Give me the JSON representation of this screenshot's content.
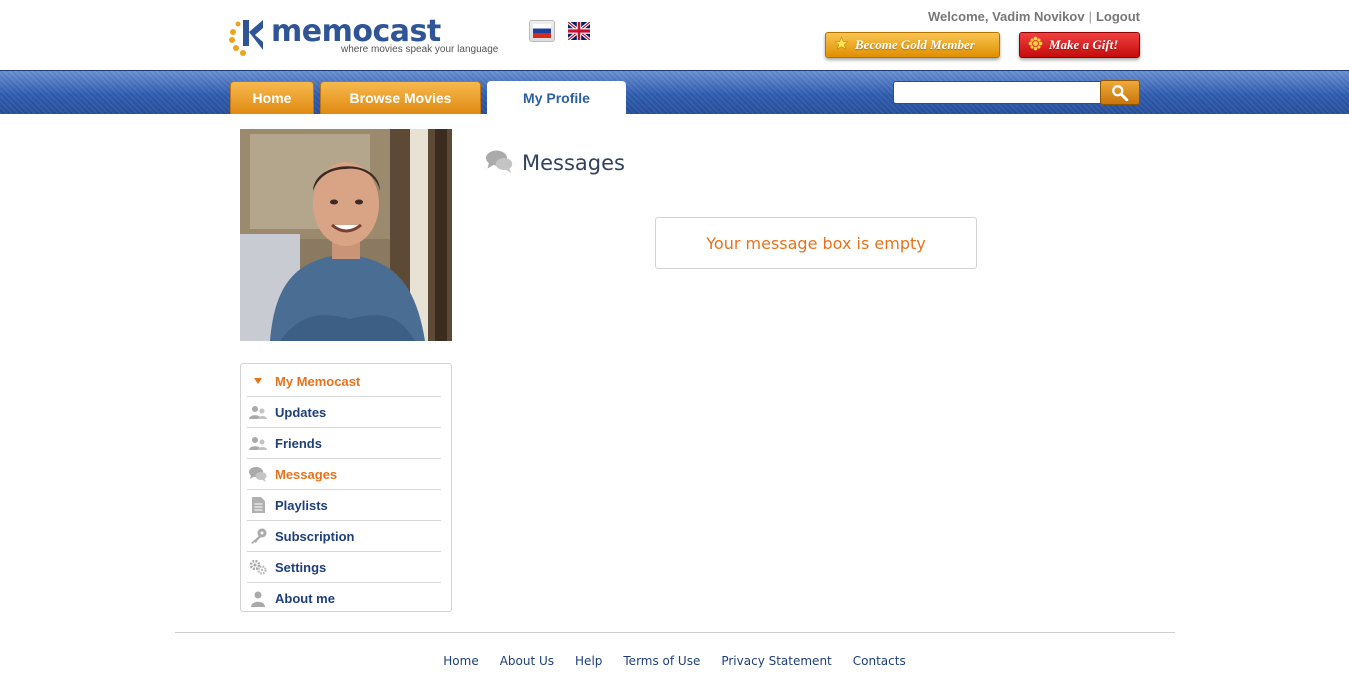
{
  "brand": {
    "name": "memocast",
    "tagline": "where movies speak your language"
  },
  "languages": [
    {
      "code": "ru",
      "icon": "russian-flag-icon"
    },
    {
      "code": "en",
      "icon": "uk-flag-icon"
    }
  ],
  "user_bar": {
    "welcome": "Welcome, Vadim Novikov",
    "separator": "|",
    "logout": "Logout"
  },
  "promo": {
    "gold_label": "Become Gold Member",
    "gift_label": "Make a Gift!"
  },
  "nav": {
    "tabs": [
      {
        "label": "Home"
      },
      {
        "label": "Browse Movies"
      },
      {
        "label": "My Profile"
      }
    ],
    "active_tab": "My Profile"
  },
  "search": {
    "value": "",
    "placeholder": ""
  },
  "sidebar": {
    "items": [
      {
        "label": "My Memocast",
        "icon": "triangle-down-icon"
      },
      {
        "label": "Updates",
        "icon": "people-icon"
      },
      {
        "label": "Friends",
        "icon": "people-icon"
      },
      {
        "label": "Messages",
        "icon": "speech-bubbles-icon"
      },
      {
        "label": "Playlists",
        "icon": "document-icon"
      },
      {
        "label": "Subscription",
        "icon": "key-icon"
      },
      {
        "label": "Settings",
        "icon": "gears-icon"
      },
      {
        "label": "About me",
        "icon": "person-icon"
      }
    ],
    "active_item": "Messages"
  },
  "main": {
    "title": "Messages",
    "empty_text": "Your message box is empty"
  },
  "footer": {
    "links": [
      "Home",
      "About Us",
      "Help",
      "Terms of Use",
      "Privacy Statement",
      "Contacts"
    ]
  },
  "colors": {
    "accent_orange": "#e8731c",
    "nav_blue": "#2e5db0",
    "link_blue": "#1f3f7a"
  }
}
